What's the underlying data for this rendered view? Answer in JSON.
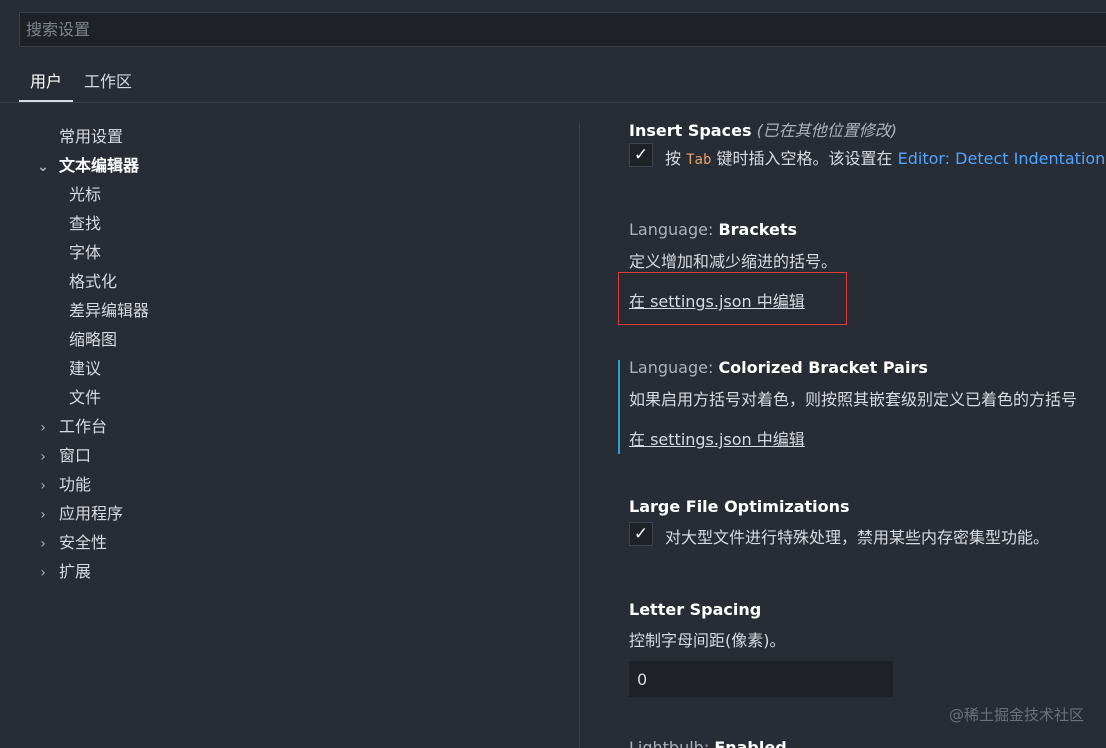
{
  "search": {
    "placeholder": "搜索设置"
  },
  "tabs": [
    {
      "label": "用户"
    },
    {
      "label": "工作区"
    }
  ],
  "toc": {
    "items": [
      {
        "label": "常用设置"
      },
      {
        "label": "文本编辑器"
      },
      {
        "label": "光标"
      },
      {
        "label": "查找"
      },
      {
        "label": "字体"
      },
      {
        "label": "格式化"
      },
      {
        "label": "差异编辑器"
      },
      {
        "label": "缩略图"
      },
      {
        "label": "建议"
      },
      {
        "label": "文件"
      },
      {
        "label": "工作台"
      },
      {
        "label": "窗口"
      },
      {
        "label": "功能"
      },
      {
        "label": "应用程序"
      },
      {
        "label": "安全性"
      },
      {
        "label": "扩展"
      }
    ]
  },
  "settings": {
    "insert_spaces": {
      "title": "Insert Spaces",
      "modified_note": "(已在其他位置修改)",
      "checked": true,
      "desc_pre": "按",
      "desc_code": "Tab",
      "desc_mid": "键时插入空格。该设置在",
      "desc_link": "Editor: Detect Indentation"
    },
    "brackets": {
      "category": "Language: ",
      "title": "Brackets",
      "desc": "定义增加和减少缩进的括号。",
      "edit_link": "在 settings.json 中编辑"
    },
    "colorized": {
      "category": "Language: ",
      "title": "Colorized Bracket Pairs",
      "desc": "如果启用方括号对着色，则按照其嵌套级别定义已着色的方括号",
      "edit_link": "在 settings.json 中编辑"
    },
    "large_file": {
      "title": "Large File Optimizations",
      "checked": true,
      "desc": "对大型文件进行特殊处理，禁用某些内存密集型功能。"
    },
    "letter_spacing": {
      "title": "Letter Spacing",
      "desc": "控制字母间距(像素)。",
      "value": "0"
    },
    "lightbulb": {
      "category": "Lightbulb: ",
      "title": "Enabled"
    }
  },
  "watermark": "@稀土掘金技术社区",
  "icons": {
    "check": "✓",
    "chevron_down": "⌄",
    "chevron_right": "›"
  }
}
